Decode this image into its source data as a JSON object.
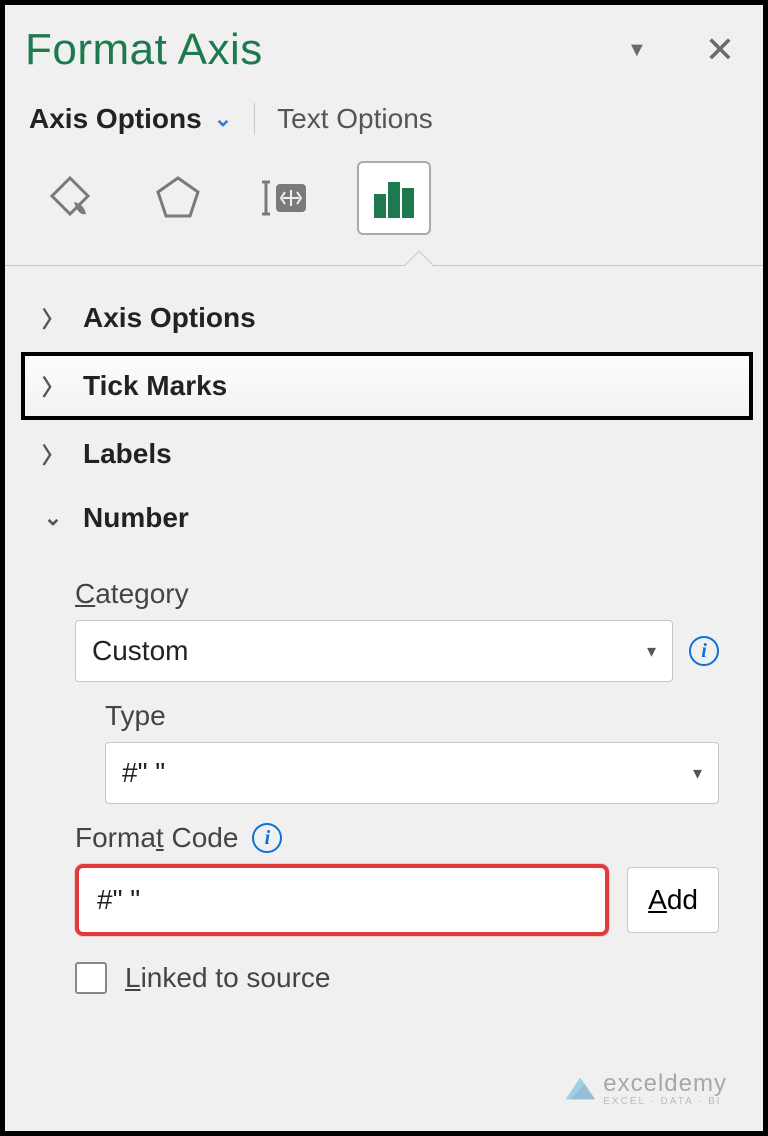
{
  "header": {
    "title": "Format Axis"
  },
  "tabs": {
    "active": "Axis Options",
    "inactive": "Text Options"
  },
  "icons": {
    "fill": "fill-line-icon",
    "effects": "effects-icon",
    "size": "size-properties-icon",
    "axis": "axis-options-chart-icon"
  },
  "sections": {
    "axis_options": "Axis Options",
    "tick_marks": "Tick Marks",
    "labels": "Labels",
    "number": "Number"
  },
  "number": {
    "category_label_pre": "C",
    "category_label_post": "ategory",
    "category_value": "Custom",
    "type_label": "Type",
    "type_value": "#\" \"",
    "format_code_label_pre": "Forma",
    "format_code_label_mid": "t",
    "format_code_label_post": " Code",
    "format_code_value": "#\" \"",
    "add_label_pre": "A",
    "add_label_post": "dd",
    "linked_pre": "L",
    "linked_post": "inked to source"
  },
  "watermark": {
    "brand": "exceldemy",
    "sub": "EXCEL · DATA · BI"
  }
}
